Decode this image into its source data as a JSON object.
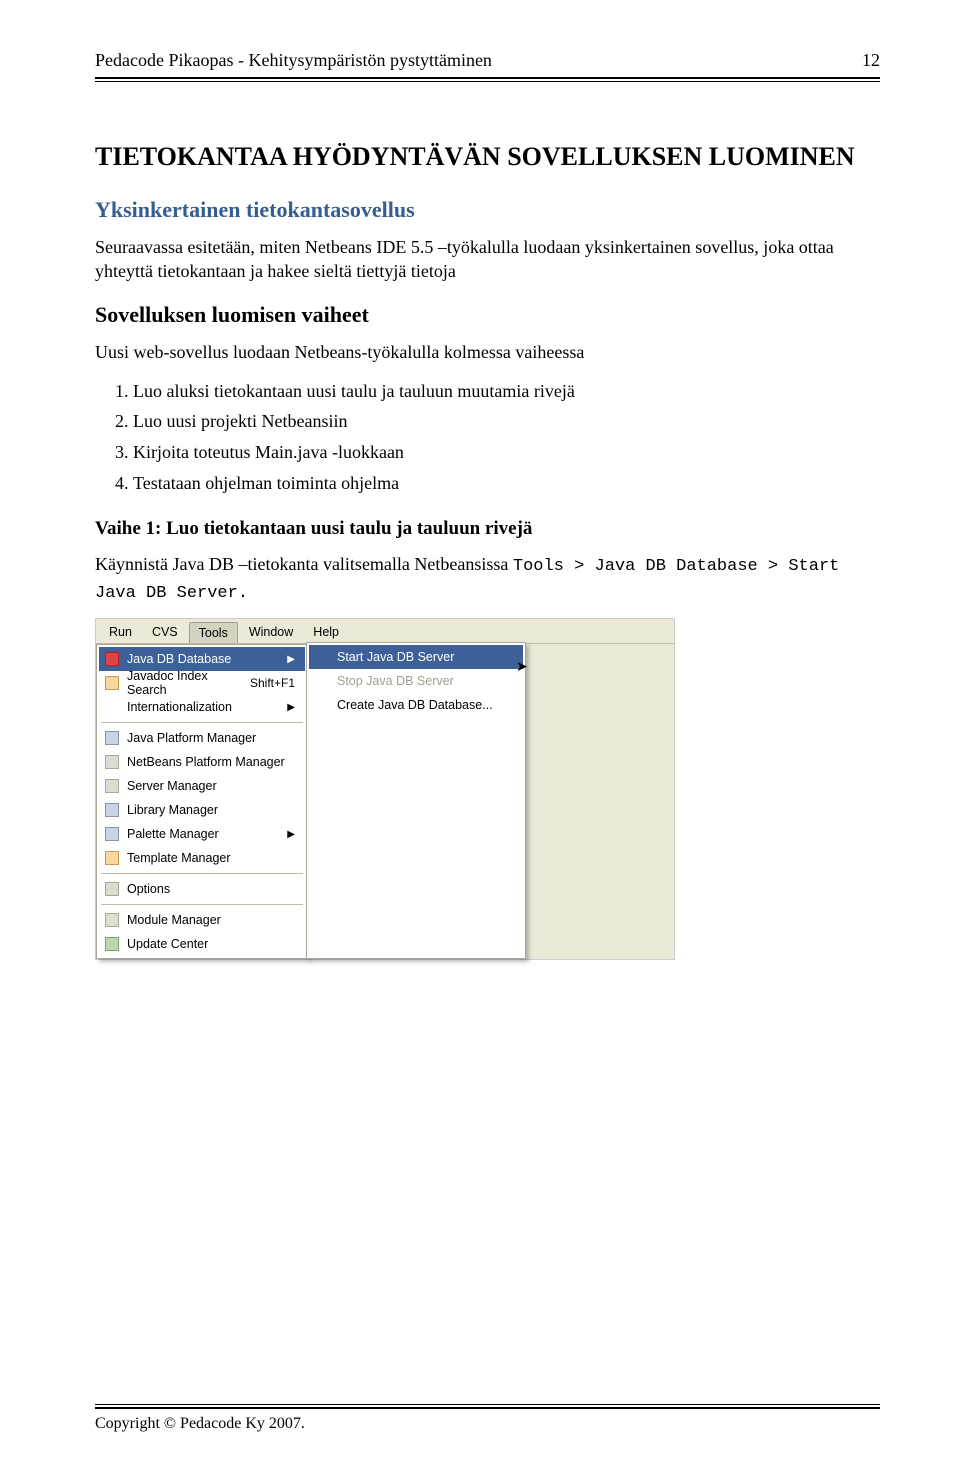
{
  "header": {
    "title": "Pedacode Pikaopas - Kehitysympäristön pystyttäminen",
    "page": "12"
  },
  "h1": "TIETOKANTAA HYÖDYNTÄVÄN SOVELLUKSEN LUOMINEN",
  "section1": {
    "title": "Yksinkertainen tietokantasovellus",
    "para": "Seuraavassa esitetään, miten Netbeans IDE 5.5 –työkalulla luodaan yksinkertainen sovellus, joka ottaa yhteyttä tietokantaan ja hakee sieltä tiettyjä tietoja"
  },
  "section2": {
    "title": "Sovelluksen luomisen vaiheet",
    "intro": "Uusi web-sovellus luodaan Netbeans-työkalulla kolmessa vaiheessa",
    "steps": [
      "Luo aluksi tietokantaan uusi taulu ja tauluun muutamia rivejä",
      "Luo uusi projekti Netbeansiin",
      "Kirjoita toteutus Main.java -luokkaan",
      "Testataan ohjelman toiminta ohjelma"
    ]
  },
  "section3": {
    "title": "Vaihe 1: Luo tietokantaan uusi taulu ja tauluun rivejä",
    "para_pre": "Käynnistä Java DB –tietokanta valitsemalla Netbeansissa ",
    "para_code": "Tools > Java DB Database > Start Java DB Server.",
    "para_post": ""
  },
  "screenshot": {
    "menubar": [
      "Run",
      "CVS",
      "Tools",
      "Window",
      "Help"
    ],
    "active_menu_index": 2,
    "main_menu": [
      {
        "label": "Java DB Database",
        "icon": "red",
        "sub": true,
        "sel": true
      },
      {
        "label": "Javadoc Index Search",
        "icon": "or",
        "shortcut": "Shift+F1"
      },
      {
        "label": "Internationalization",
        "icon": "",
        "sub": true
      },
      {
        "divider": true
      },
      {
        "label": "Java Platform Manager",
        "icon": "bl"
      },
      {
        "label": "NetBeans Platform Manager",
        "icon": "gy"
      },
      {
        "label": "Server Manager",
        "icon": "gy"
      },
      {
        "label": "Library Manager",
        "icon": "bl"
      },
      {
        "label": "Palette Manager",
        "icon": "bl",
        "sub": true
      },
      {
        "label": "Template Manager",
        "icon": "or"
      },
      {
        "divider": true
      },
      {
        "label": "Options",
        "icon": "gy"
      },
      {
        "divider": true
      },
      {
        "label": "Module Manager",
        "icon": "gy"
      },
      {
        "label": "Update Center",
        "icon": "gn"
      }
    ],
    "sub_menu": [
      {
        "label": "Start Java DB Server",
        "sel": true
      },
      {
        "label": "Stop Java DB Server",
        "dis": true
      },
      {
        "label": "Create Java DB Database..."
      }
    ]
  },
  "footer": {
    "copyright": "Copyright © Pedacode Ky 2007."
  }
}
